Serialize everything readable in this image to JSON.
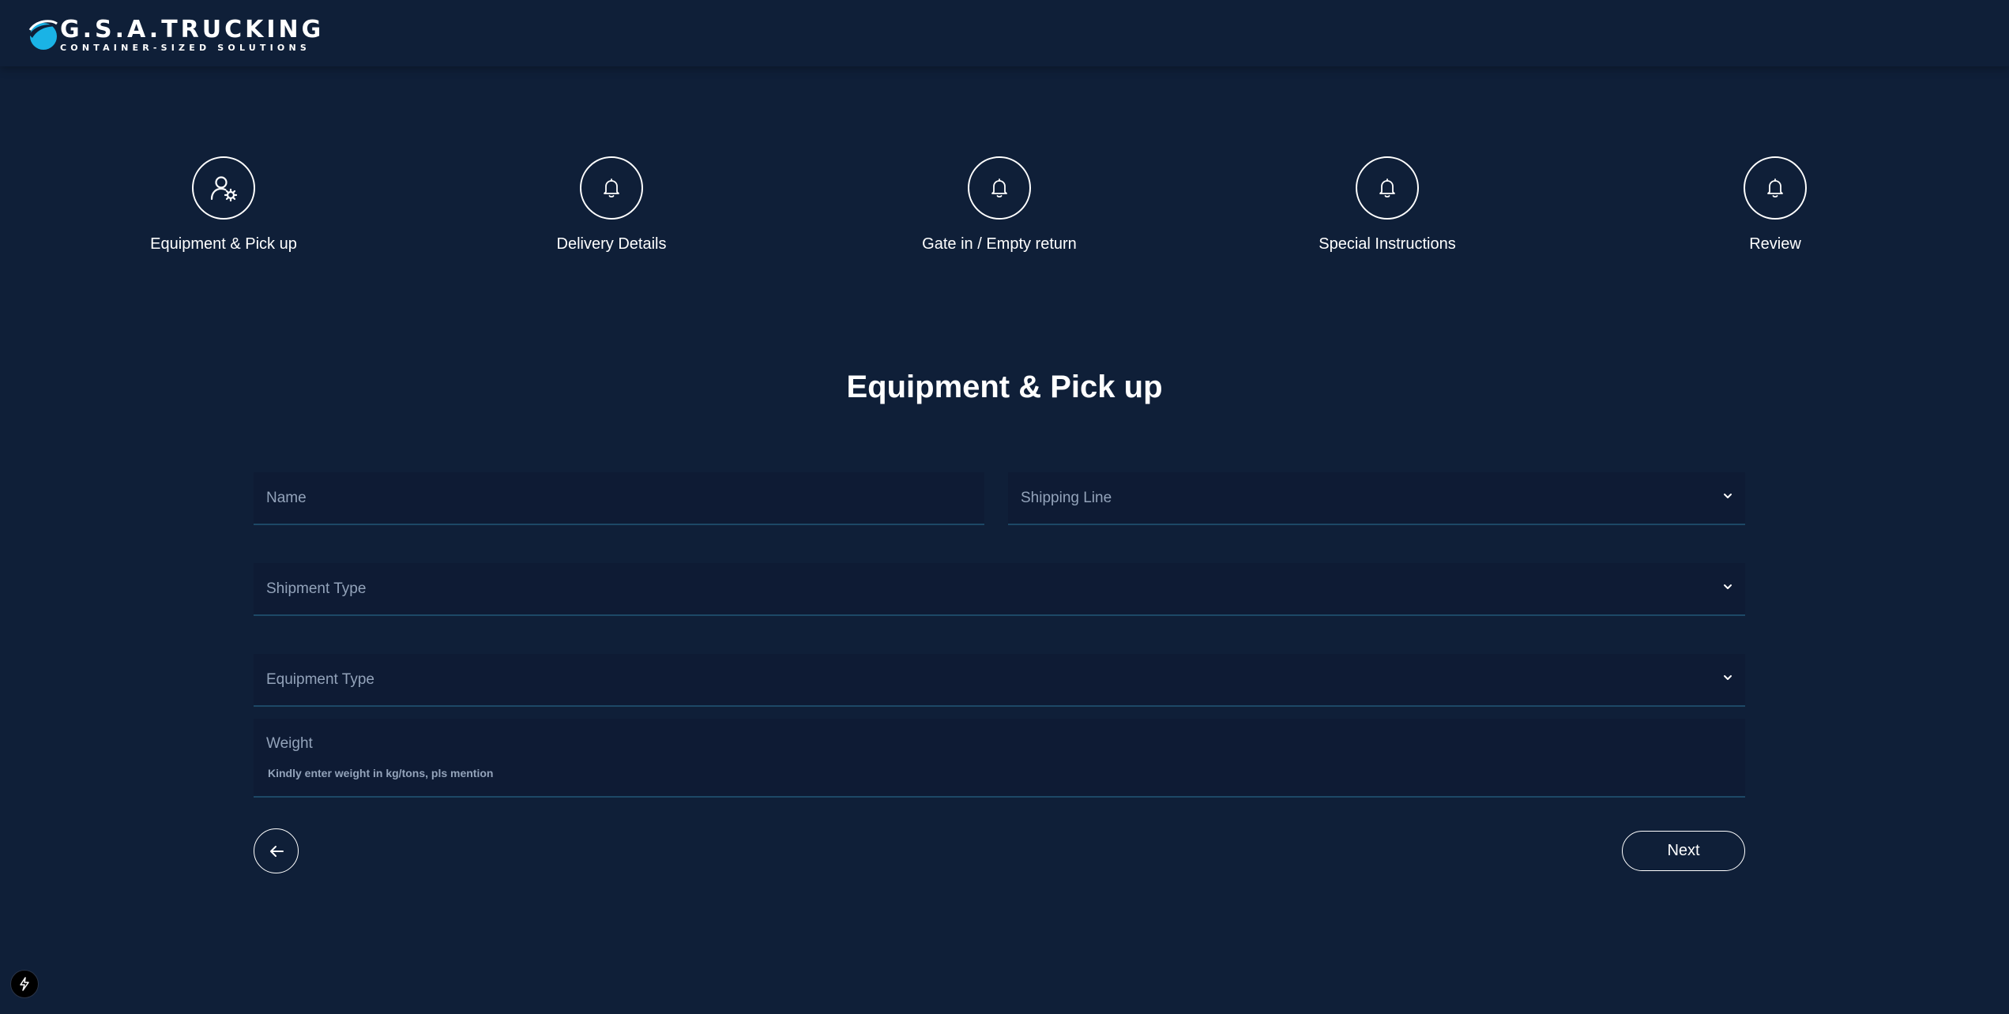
{
  "brand": {
    "title": "G.S.A.TRUCKING",
    "subtitle": "CONTAINER-SIZED SOLUTIONS",
    "accent_color": "#1ab3e6"
  },
  "steps": [
    {
      "label": "Equipment & Pick up",
      "icon": "user-gear-icon"
    },
    {
      "label": "Delivery Details",
      "icon": "bell-icon"
    },
    {
      "label": "Gate in / Empty return",
      "icon": "bell-icon"
    },
    {
      "label": "Special Instructions",
      "icon": "bell-icon"
    },
    {
      "label": "Review",
      "icon": "bell-icon"
    }
  ],
  "form": {
    "title": "Equipment & Pick up",
    "name": {
      "placeholder": "Name",
      "value": ""
    },
    "shipping_line": {
      "placeholder": "Shipping Line",
      "value": ""
    },
    "shipment_type": {
      "placeholder": "Shipment Type",
      "value": ""
    },
    "equipment_type": {
      "placeholder": "Equipment Type",
      "value": ""
    },
    "weight": {
      "placeholder": "Weight",
      "helper": "Kindly enter weight in kg/tons, pls mention",
      "value": ""
    }
  },
  "actions": {
    "back_icon": "arrow-left-icon",
    "next_label": "Next"
  },
  "corner_badge_icon": "lightning-icon",
  "colors": {
    "background": "#0f1f38",
    "field_background": "#0e1b34",
    "field_underline": "#1d4866",
    "placeholder_text": "#93a3ba"
  }
}
